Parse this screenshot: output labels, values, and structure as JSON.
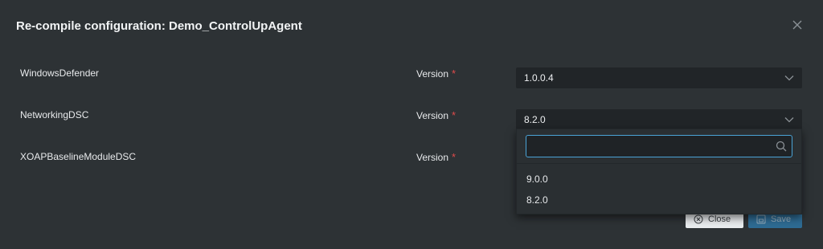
{
  "dialog": {
    "title": "Re-compile configuration: Demo_ControlUpAgent"
  },
  "rows": [
    {
      "name": "WindowsDefender",
      "version_label": "Version",
      "required_marker": "*",
      "selected": "1.0.0.4"
    },
    {
      "name": "NetworkingDSC",
      "version_label": "Version",
      "required_marker": "*",
      "selected": "8.2.0"
    },
    {
      "name": "XOAPBaselineModuleDSC",
      "version_label": "Version",
      "required_marker": "*",
      "selected": ""
    }
  ],
  "dropdown": {
    "search_value": "",
    "search_placeholder": "",
    "options": [
      "9.0.0",
      "8.2.0"
    ]
  },
  "footer": {
    "close_label": "Close",
    "save_label": "Save"
  },
  "colors": {
    "background": "#2d3235",
    "select_bg": "#212528",
    "accent": "#4aa3d6",
    "required": "#e04b4b",
    "save_button": "#2f7fb3"
  },
  "icons": {
    "close": "x-icon",
    "chevron": "chevron-down-icon",
    "search": "search-icon",
    "close_button": "circle-x-icon",
    "save_button": "save-icon"
  }
}
